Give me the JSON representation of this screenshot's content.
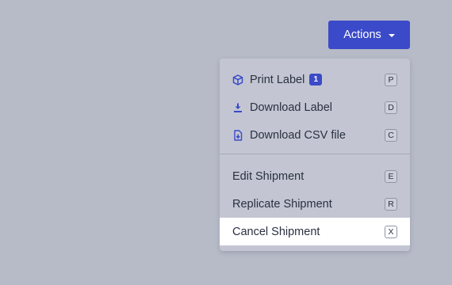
{
  "actions_button": {
    "label": "Actions"
  },
  "menu": {
    "items": [
      {
        "label": "Print Label",
        "icon": "package-icon",
        "badge": "1",
        "shortcut": "P"
      },
      {
        "label": "Download Label",
        "icon": "download-icon",
        "shortcut": "D"
      },
      {
        "label": "Download CSV file",
        "icon": "csv-file-download-icon",
        "shortcut": "C"
      },
      {
        "label": "Edit Shipment",
        "shortcut": "E"
      },
      {
        "label": "Replicate Shipment",
        "shortcut": "R"
      },
      {
        "label": "Cancel Shipment",
        "shortcut": "X",
        "highlighted": true
      }
    ]
  },
  "colors": {
    "background": "#b7bac7",
    "accent": "#3b4ac8",
    "menu_background": "#c3c6d2",
    "highlight": "#ffffff",
    "text": "#2a3040"
  }
}
